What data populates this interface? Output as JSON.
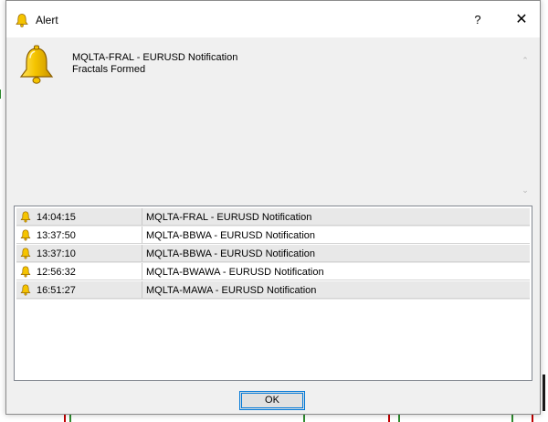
{
  "window": {
    "title": "Alert",
    "help_label": "?",
    "close_label": "✕"
  },
  "message": {
    "line1": "MQLTA-FRAL - EURUSD Notification",
    "line2": "Fractals Formed"
  },
  "alerts": [
    {
      "time": "14:04:15",
      "name": "MQLTA-FRAL - EURUSD Notification"
    },
    {
      "time": "13:37:50",
      "name": "MQLTA-BBWA - EURUSD Notification"
    },
    {
      "time": "13:37:10",
      "name": "MQLTA-BBWA - EURUSD Notification"
    },
    {
      "time": "12:56:32",
      "name": "MQLTA-BWAWA - EURUSD Notification"
    },
    {
      "time": "16:51:27",
      "name": "MQLTA-MAWA - EURUSD Notification"
    }
  ],
  "buttons": {
    "ok_label": "OK"
  },
  "icons": {
    "window_icon": "bell-icon",
    "message_icon": "bell-icon",
    "row_icon": "bell-icon"
  },
  "colors": {
    "bell_fill": "#f5c400",
    "bell_stroke": "#9a6a00",
    "ok_border": "#0078d7",
    "row_alt": "#e8e8e8"
  }
}
